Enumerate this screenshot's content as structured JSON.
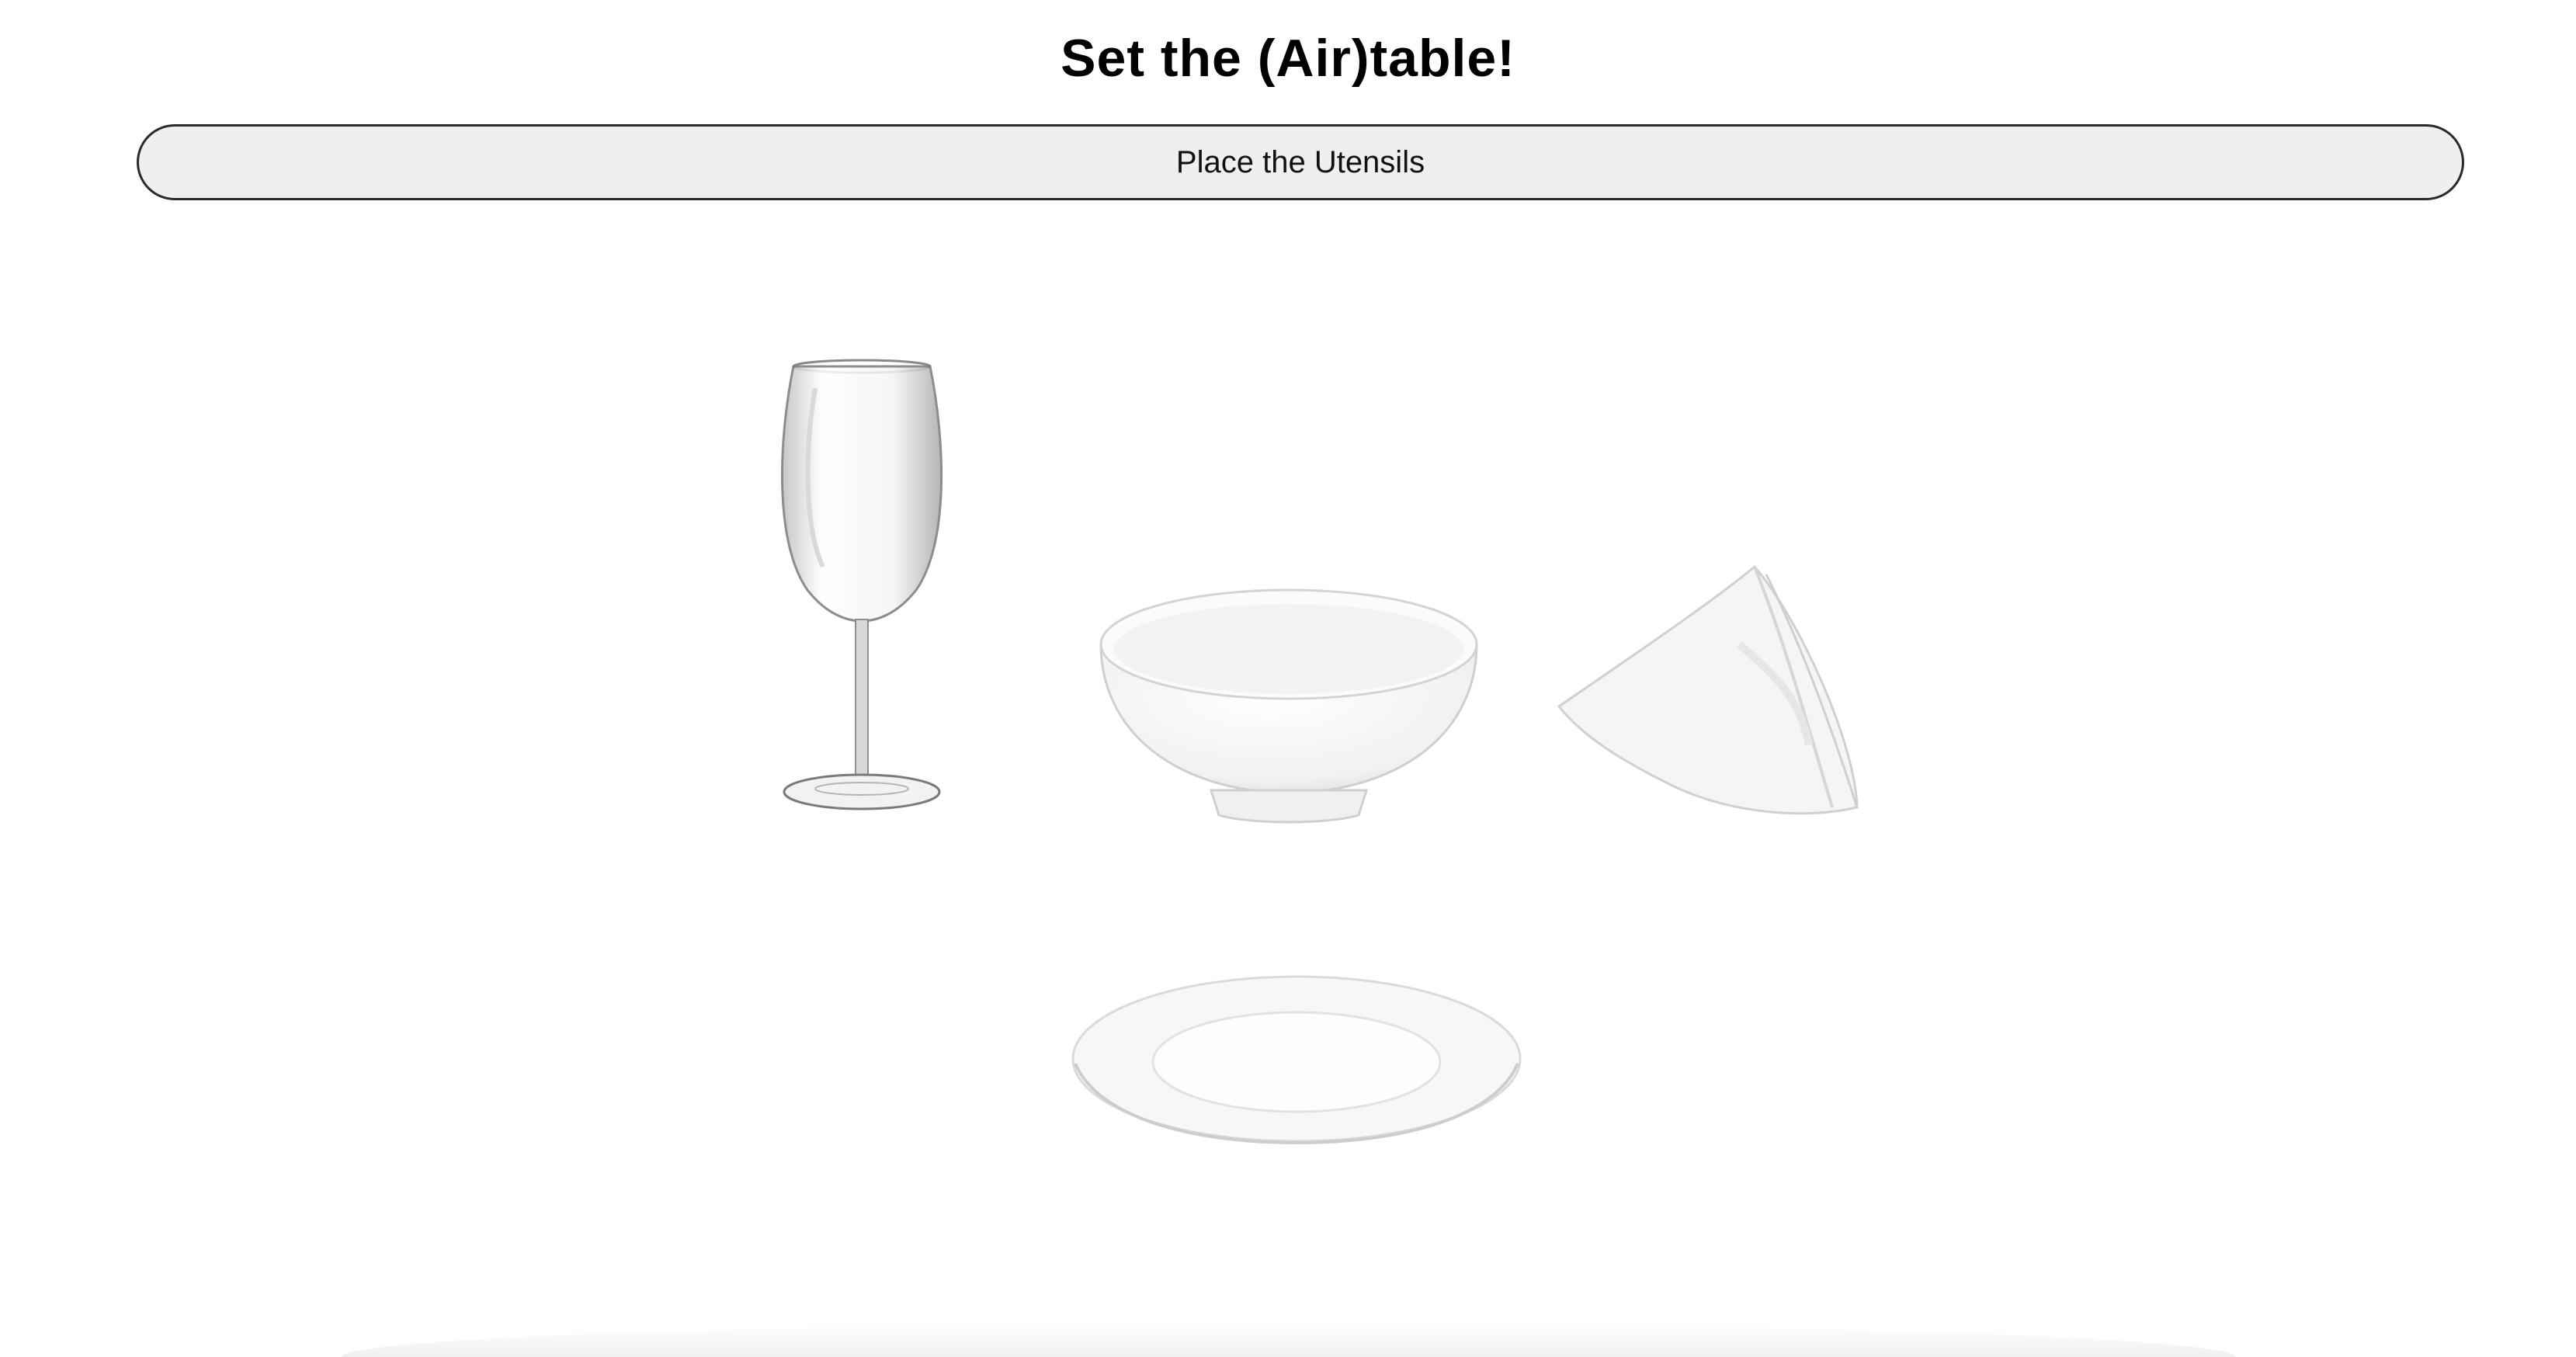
{
  "header": {
    "title": "Set the (Air)table!"
  },
  "controls": {
    "place_button_label": "Place the Utensils"
  },
  "utensils": [
    {
      "name": "wine-glass",
      "icon": "wine-glass-icon"
    },
    {
      "name": "bowl",
      "icon": "bowl-icon"
    },
    {
      "name": "napkin",
      "icon": "napkin-icon"
    },
    {
      "name": "plate",
      "icon": "plate-icon"
    }
  ],
  "colors": {
    "background": "#ffffff",
    "button_bg": "#efefef",
    "button_border": "#2a2a2a",
    "title": "#000000"
  }
}
